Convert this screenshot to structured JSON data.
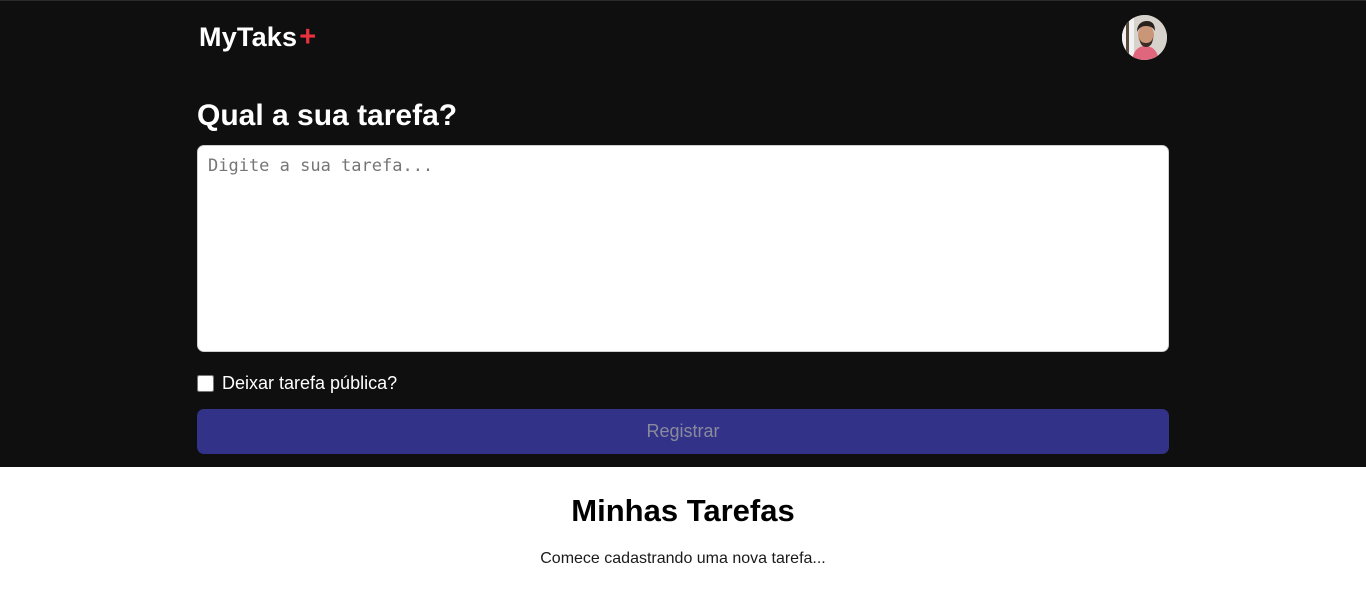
{
  "header": {
    "brand": "MyTaks",
    "brand_accent": "+",
    "avatar_alt": "avatar"
  },
  "form": {
    "question": "Qual a sua tarefa?",
    "task_placeholder": "Digite a sua tarefa...",
    "task_value": "",
    "public_label": "Deixar tarefa pública?",
    "public_checked": false,
    "register_label": "Registrar"
  },
  "tasks": {
    "title": "Minhas Tarefas",
    "empty_message": "Comece cadastrando uma nova tarefa..."
  },
  "colors": {
    "header_bg": "#0f0f0f",
    "accent": "#ea3140",
    "button_bg": "#323288",
    "button_text": "#8a8a9e"
  },
  "icons": {
    "avatar": "user-photo-avatar"
  }
}
